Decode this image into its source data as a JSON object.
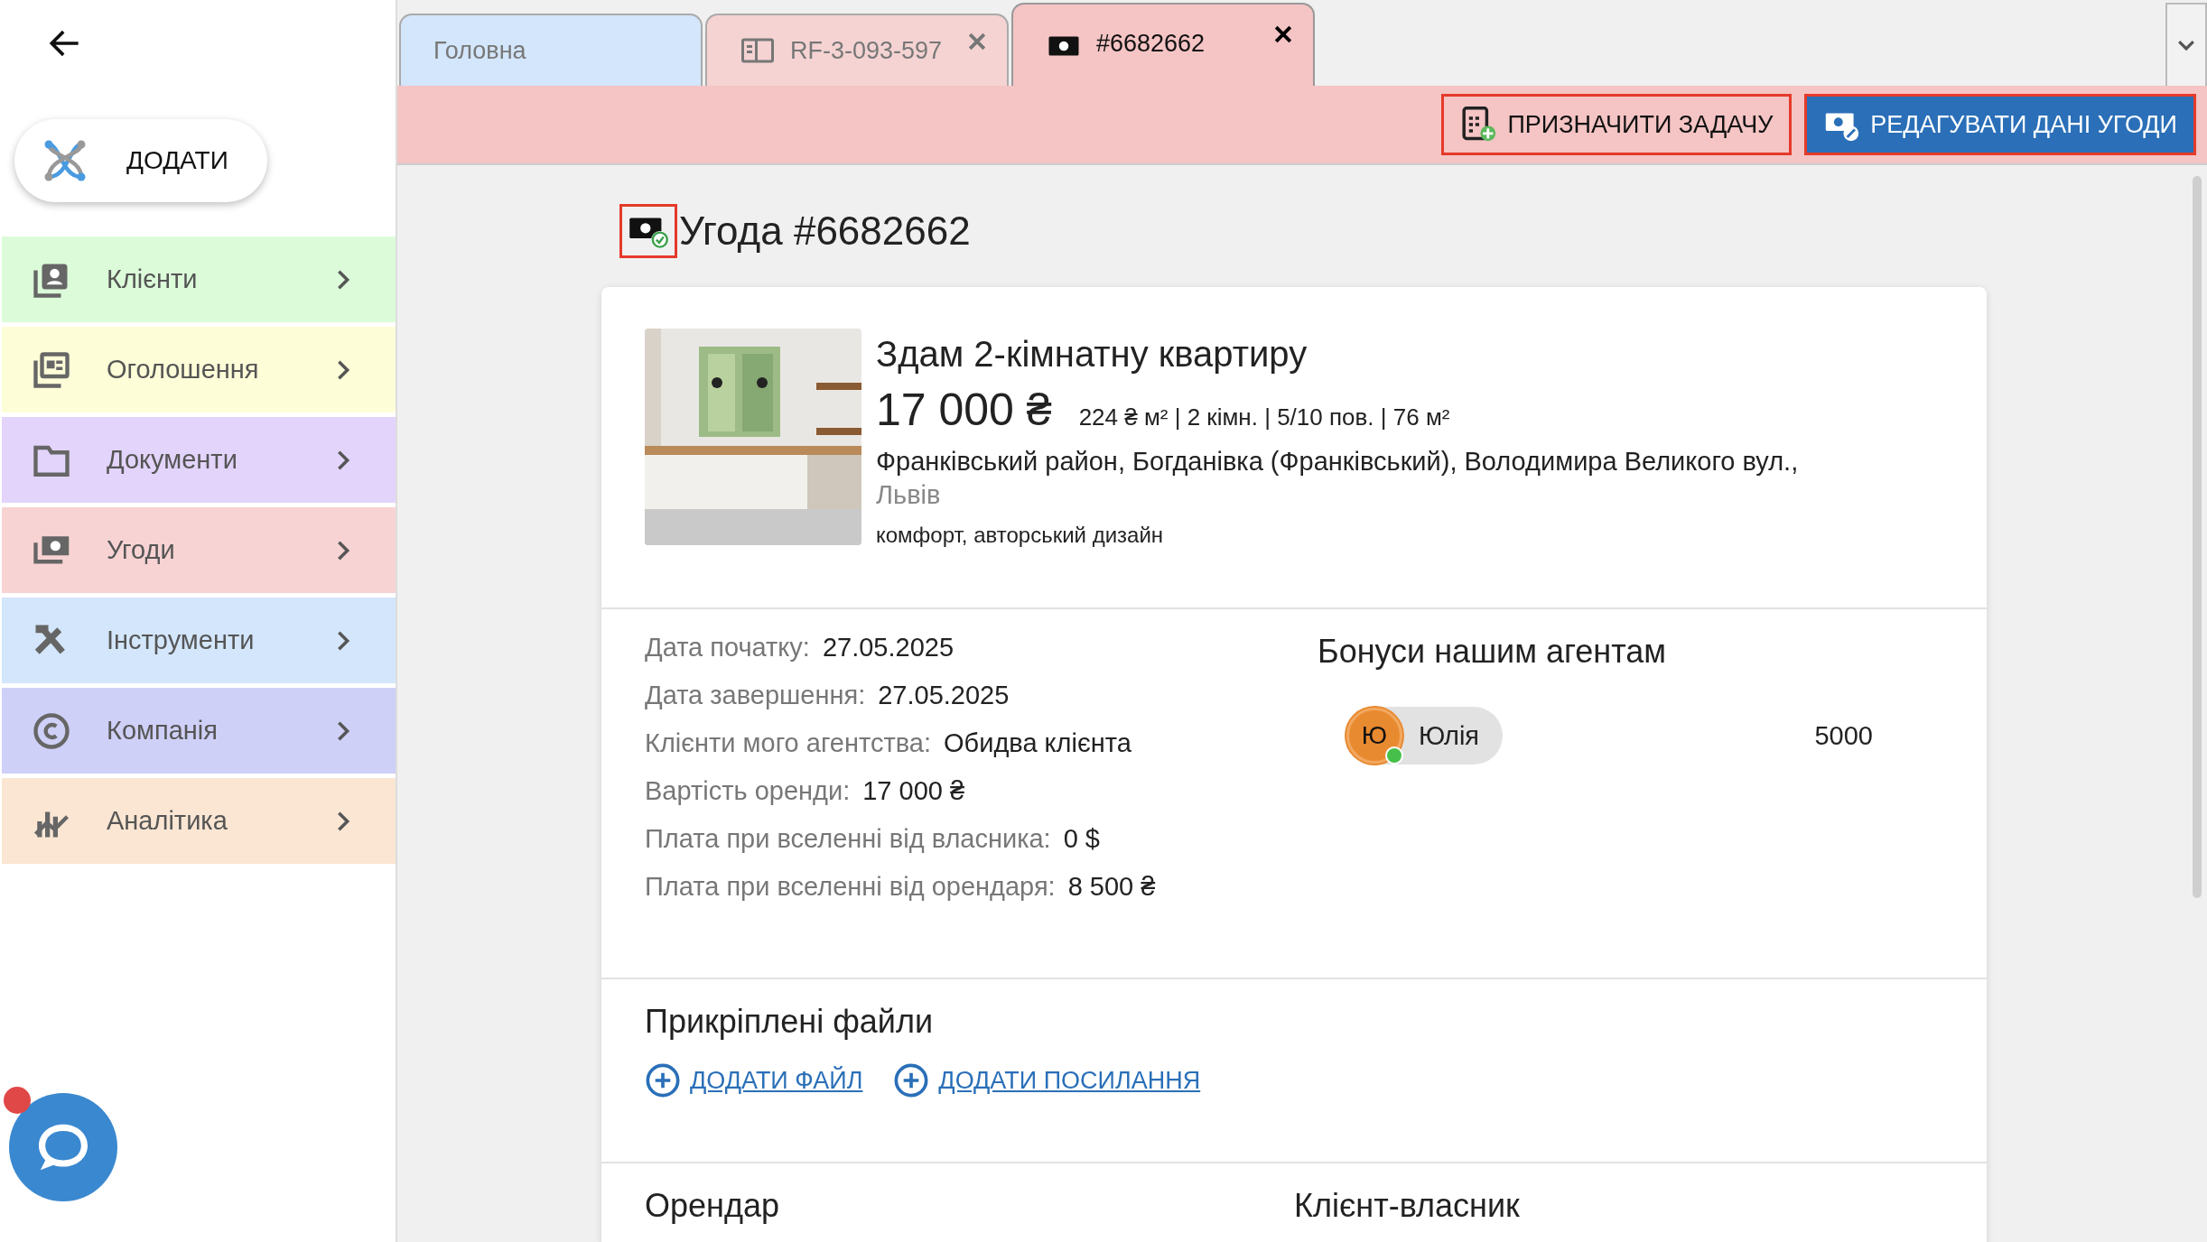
{
  "sidebar": {
    "add_button": {
      "label": "ДОДАТИ"
    },
    "items": [
      {
        "kind": "clients",
        "label": "Клієнти",
        "color": "#dcfcd9"
      },
      {
        "kind": "listings",
        "label": "Оголошення",
        "color": "#fdfdd8"
      },
      {
        "kind": "documents",
        "label": "Документи",
        "color": "#e3d4fb"
      },
      {
        "kind": "deals",
        "label": "Угоди",
        "color": "#f8d3d3"
      },
      {
        "kind": "tools",
        "label": "Інструменти",
        "color": "#d3e6fb"
      },
      {
        "kind": "company",
        "label": "Компанія",
        "color": "#cfd0f7"
      },
      {
        "kind": "analytics",
        "label": "Аналітика",
        "color": "#fae6d3"
      }
    ],
    "chat": {
      "unread": true
    }
  },
  "tabs": [
    {
      "kind": "home",
      "label": "Головна",
      "selected": false,
      "closable": false,
      "color": "#d3e6fb"
    },
    {
      "kind": "listing",
      "label": "RF-3-093-597",
      "selected": false,
      "closable": true,
      "color": "#f5d3d3"
    },
    {
      "kind": "deal",
      "label": "#6682662",
      "selected": true,
      "closable": true,
      "color": "#f5c4c4"
    }
  ],
  "toolbar": {
    "buttons": [
      {
        "kind": "assign",
        "label": "ПРИЗНАЧИТИ ЗАДАЧУ",
        "highlighted": true
      },
      {
        "kind": "edit",
        "label": "РЕДАГУВАТИ ДАНІ УГОДИ",
        "highlighted": true
      }
    ]
  },
  "deal": {
    "title": "Угода #6682662",
    "icon_highlighted": true,
    "listing": {
      "title": "Здам 2-кімнатну квартиру",
      "price": "17 000 ₴",
      "specs": "224 ₴ м² | 2 кімн. | 5/10 пов. | 76 м²",
      "address": "Франківський район, Богданівка (Франківський), Володимира Великого вул.,",
      "city": "Львів",
      "tags": "комфорт, авторський дизайн"
    },
    "fields": [
      {
        "label": "Дата початку:",
        "value": "27.05.2025"
      },
      {
        "label": "Дата завершення:",
        "value": "27.05.2025"
      },
      {
        "label": "Клієнти мого агентства:",
        "value": "Обидва клієнта"
      },
      {
        "label": "Вартість оренди:",
        "value": "17 000 ₴"
      },
      {
        "label": "Плата при вселенні від власника:",
        "value": "0 $"
      },
      {
        "label": "Плата при вселенні від орендаря:",
        "value": "8 500 ₴"
      }
    ],
    "bonuses": {
      "title": "Бонуси нашим агентам",
      "agents": [
        {
          "initial": "Ю",
          "name": "Юлія",
          "online": true,
          "amount": "5000"
        }
      ]
    },
    "files": {
      "title": "Прикріплені файли",
      "links": [
        "ДОДАТИ ФАЙЛ",
        "ДОДАТИ ПОСИЛАННЯ"
      ]
    },
    "parties": [
      "Орендар",
      "Клієнт-власник"
    ]
  }
}
